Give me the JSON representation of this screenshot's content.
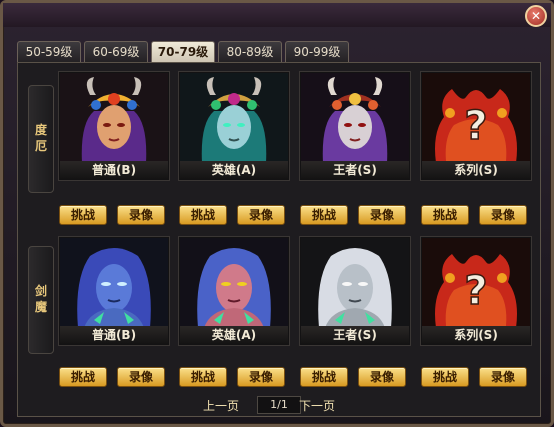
{
  "window": {
    "close_glyph": "✕"
  },
  "tabs": [
    {
      "label": "50-59级",
      "active": false
    },
    {
      "label": "60-69级",
      "active": false
    },
    {
      "label": "70-79级",
      "active": true
    },
    {
      "label": "80-89级",
      "active": false
    },
    {
      "label": "90-99级",
      "active": false
    }
  ],
  "rows": [
    {
      "label_chars": [
        "度",
        "厄"
      ],
      "cards": [
        {
          "name": "普通(B)",
          "portrait": "demon-queen-orange"
        },
        {
          "name": "英雄(A)",
          "portrait": "demon-queen-teal"
        },
        {
          "name": "王者(S)",
          "portrait": "demon-queen-purple"
        },
        {
          "name": "系列(S)",
          "portrait": "mystery-red"
        }
      ]
    },
    {
      "label_chars": [
        "剑",
        "魔"
      ],
      "cards": [
        {
          "name": "普通(B)",
          "portrait": "sword-demon-blue"
        },
        {
          "name": "英雄(A)",
          "portrait": "sword-demon-pink"
        },
        {
          "name": "王者(S)",
          "portrait": "sword-demon-white"
        },
        {
          "name": "系列(S)",
          "portrait": "mystery-red"
        }
      ]
    }
  ],
  "buttons": {
    "challenge": "挑战",
    "replay": "录像"
  },
  "pager": {
    "prev": "上一页",
    "page": "1/1",
    "next": "下一页"
  },
  "colors": {
    "accent_gold": "#e8c87c",
    "button_gold": "#f2c04a",
    "frame": "#6a5846"
  }
}
